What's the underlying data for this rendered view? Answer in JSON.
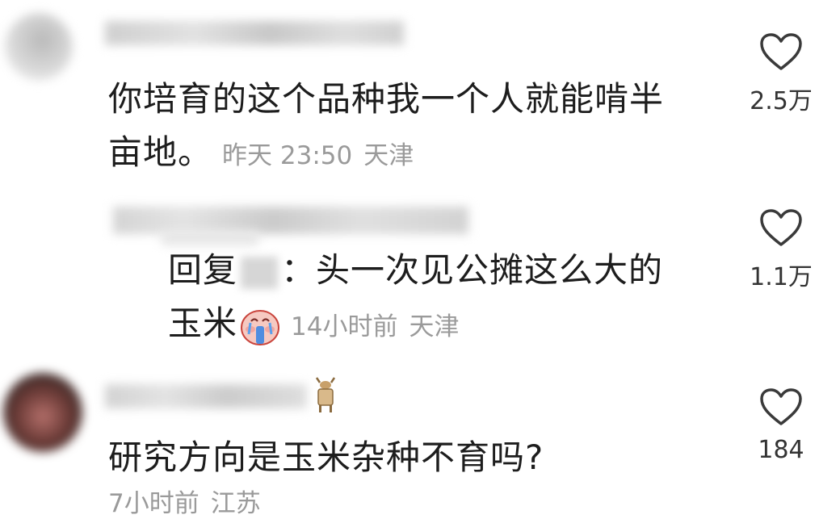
{
  "comments": [
    {
      "text_line1": "你培育的这个品种我一个人就能啃半",
      "text_line2": "亩地。",
      "time": "昨天 23:50",
      "location": "天津",
      "likes": "2.5万"
    },
    {
      "reply_prefix": "回复",
      "reply_sep": "：",
      "text_line1": "头一次见公摊这么大的",
      "text_line2": "玉米",
      "emoji": "crying-laughing-emoji-icon",
      "time": "14小时前",
      "location": "天津",
      "likes": "1.1万"
    },
    {
      "text_line1": "研究方向是玉米杂种不育吗?",
      "time": "7小时前",
      "location": "江苏",
      "likes": "184"
    }
  ],
  "colors": {
    "text": "#1d1d1d",
    "meta": "#9a9a9a",
    "heart_outline": "#3a3a3a"
  }
}
